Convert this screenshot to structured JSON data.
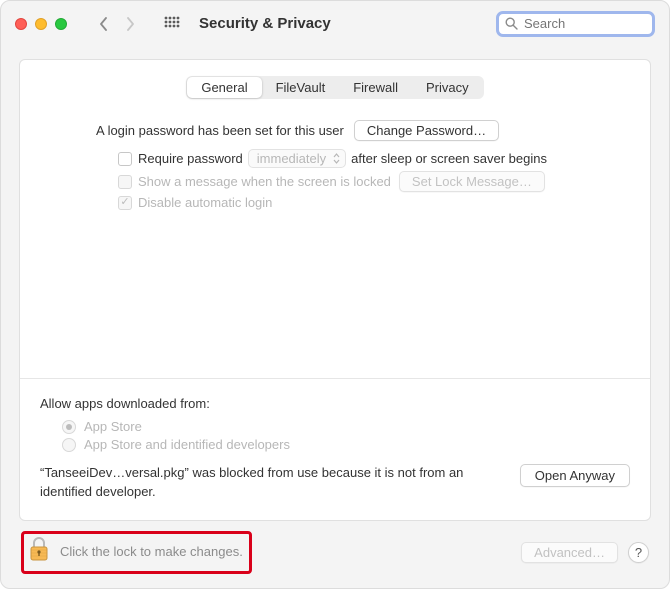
{
  "window": {
    "title": "Security & Privacy"
  },
  "search": {
    "placeholder": "Search"
  },
  "tabs": [
    "General",
    "FileVault",
    "Firewall",
    "Privacy"
  ],
  "general": {
    "login_password_set": "A login password has been set for this user",
    "change_password": "Change Password…",
    "require_password": "Require password",
    "require_delay": "immediately",
    "after_sleep": "after sleep or screen saver begins",
    "show_message": "Show a message when the screen is locked",
    "set_lock_message": "Set Lock Message…",
    "disable_auto_login": "Disable automatic login"
  },
  "allow": {
    "heading": "Allow apps downloaded from:",
    "opt1": "App Store",
    "opt2": "App Store and identified developers",
    "blocked_msg": "“TanseeiDev…versal.pkg” was blocked from use because it is not from an identified developer.",
    "open_anyway": "Open Anyway"
  },
  "footer": {
    "lock_text": "Click the lock to make changes.",
    "advanced": "Advanced…",
    "help": "?"
  }
}
